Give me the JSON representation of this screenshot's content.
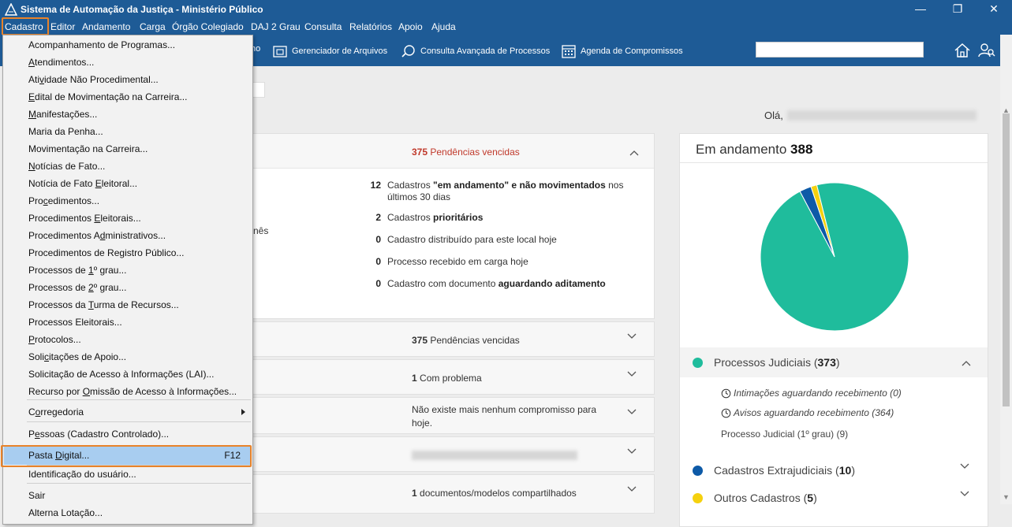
{
  "window": {
    "title": "Sistema de Automação da Justiça - Ministério Público",
    "minimize": "—",
    "restore": "❐",
    "close": "✕"
  },
  "menubar": {
    "items": [
      "Cadastro",
      "Editor",
      "Andamento",
      "Carga",
      "Órgão Colegiado",
      "DAJ 2 Grau",
      "Consulta",
      "Relatórios",
      "Apoio",
      "Ajuda"
    ]
  },
  "toolbar": {
    "partial_label": "ho",
    "items": [
      {
        "label": "Gerenciador de Arquivos",
        "icon": "folder-icon"
      },
      {
        "label": "Consulta Avançada de Processos",
        "icon": "search-icon"
      },
      {
        "label": "Agenda de Compromissos",
        "icon": "calendar-icon"
      }
    ],
    "search_placeholder": ""
  },
  "greeting": {
    "label": "Olá,"
  },
  "dropdown": {
    "items": [
      {
        "pre": "Acompanhamento de Programas...",
        "ul": "",
        "post": ""
      },
      {
        "pre": "",
        "ul": "A",
        "post": "tendimentos..."
      },
      {
        "pre": "Ati",
        "ul": "v",
        "post": "idade Não Procedimental..."
      },
      {
        "pre": "",
        "ul": "E",
        "post": "dital de Movimentação na Carreira..."
      },
      {
        "pre": "",
        "ul": "M",
        "post": "anifestações..."
      },
      {
        "pre": "Maria da Penha...",
        "ul": "",
        "post": ""
      },
      {
        "pre": "Movimentação na Carreira...",
        "ul": "",
        "post": ""
      },
      {
        "pre": "",
        "ul": "N",
        "post": "otícias de Fato..."
      },
      {
        "pre": "Notícia de Fato ",
        "ul": "E",
        "post": "leitoral..."
      },
      {
        "pre": "Pro",
        "ul": "c",
        "post": "edimentos..."
      },
      {
        "pre": "Procedimentos ",
        "ul": "E",
        "post": "leitorais..."
      },
      {
        "pre": "Procedimentos A",
        "ul": "d",
        "post": "ministrativos..."
      },
      {
        "pre": "Procedimentos de Registro Público...",
        "ul": "",
        "post": ""
      },
      {
        "pre": "Processos de ",
        "ul": "1",
        "post": "º grau..."
      },
      {
        "pre": "Processos de ",
        "ul": "2",
        "post": "º grau..."
      },
      {
        "pre": "Processos da ",
        "ul": "T",
        "post": "urma de Recursos..."
      },
      {
        "pre": "Processos Eleitorais...",
        "ul": "",
        "post": ""
      },
      {
        "pre": "",
        "ul": "P",
        "post": "rotocolos..."
      },
      {
        "pre": "Soli",
        "ul": "c",
        "post": "itações de Apoio..."
      },
      {
        "pre": "Solicitação de Acesso à Informações (LAI)...",
        "ul": "",
        "post": ""
      },
      {
        "pre": "Recurso por ",
        "ul": "O",
        "post": "missão de Acesso à Informações..."
      },
      {
        "pre": "C",
        "ul": "o",
        "post": "rregedoria"
      },
      {
        "pre": "P",
        "ul": "e",
        "post": "ssoas (Cadastro Controlado)..."
      },
      {
        "pre": "Pasta ",
        "ul": "D",
        "post": "igital..."
      },
      {
        "pre": "Identificação do usuário...",
        "ul": "",
        "post": ""
      },
      {
        "pre": "Sair",
        "ul": "",
        "post": ""
      },
      {
        "pre": "Alterna Lotação...",
        "ul": "",
        "post": ""
      }
    ],
    "pasta_shortcut": "F12"
  },
  "main_panel": {
    "pending": "375 Pendências vencidas",
    "pending_num": "375",
    "pending_txt": " Pendências vencidas",
    "partial_left": "nês",
    "stats": [
      {
        "num": "12",
        "pre": "Cadastros ",
        "bold": "\"em andamento\" e não movimentados",
        "post": " nos",
        "line2": "últimos 30 dias"
      },
      {
        "num": "2",
        "pre": "Cadastros ",
        "bold": "prioritários",
        "post": "",
        "line2": ""
      },
      {
        "num": "0",
        "pre": "Cadastro distribuído para este local hoje",
        "bold": "",
        "post": "",
        "line2": ""
      },
      {
        "num": "0",
        "pre": "Processo recebido em carga hoje",
        "bold": "",
        "post": "",
        "line2": ""
      },
      {
        "num": "0",
        "pre": "Cadastro com documento ",
        "bold": "aguardando aditamento",
        "post": "",
        "line2": ""
      }
    ]
  },
  "rows": [
    {
      "num": "375",
      "text": " Pendências vencidas",
      "red": true
    },
    {
      "num": "1",
      "text": " Com problema",
      "red": true
    },
    {
      "num": "",
      "text": "Não existe mais nenhum compromisso para",
      "line2": "hoje.",
      "red": false
    },
    {
      "num": "",
      "text": "",
      "red": false
    },
    {
      "num": "1",
      "text": " documentos/modelos compartilhados",
      "red": false
    }
  ],
  "chart_panel": {
    "title": "Em andamento",
    "total": "388",
    "legend": [
      {
        "name": "Processos Judiciais",
        "count": "373",
        "color": "#1fbc9c"
      },
      {
        "name": "Cadastros Extrajudiciais",
        "count": "10",
        "color": "#0d5aa7"
      },
      {
        "name": "Outros Cadastros",
        "count": "5",
        "color": "#f5d10e"
      }
    ],
    "sub_items": [
      "Intimações aguardando recebimento (0)",
      "Avisos aguardando recebimento (364)",
      "Processo Judicial (1º grau) (9)"
    ]
  },
  "chart_data": {
    "type": "pie",
    "categories": [
      "Processos Judiciais",
      "Cadastros Extrajudiciais",
      "Outros Cadastros"
    ],
    "values": [
      373,
      10,
      5
    ],
    "colors": [
      "#1fbc9c",
      "#0d5aa7",
      "#f5d10e"
    ],
    "title": "Em andamento 388"
  }
}
